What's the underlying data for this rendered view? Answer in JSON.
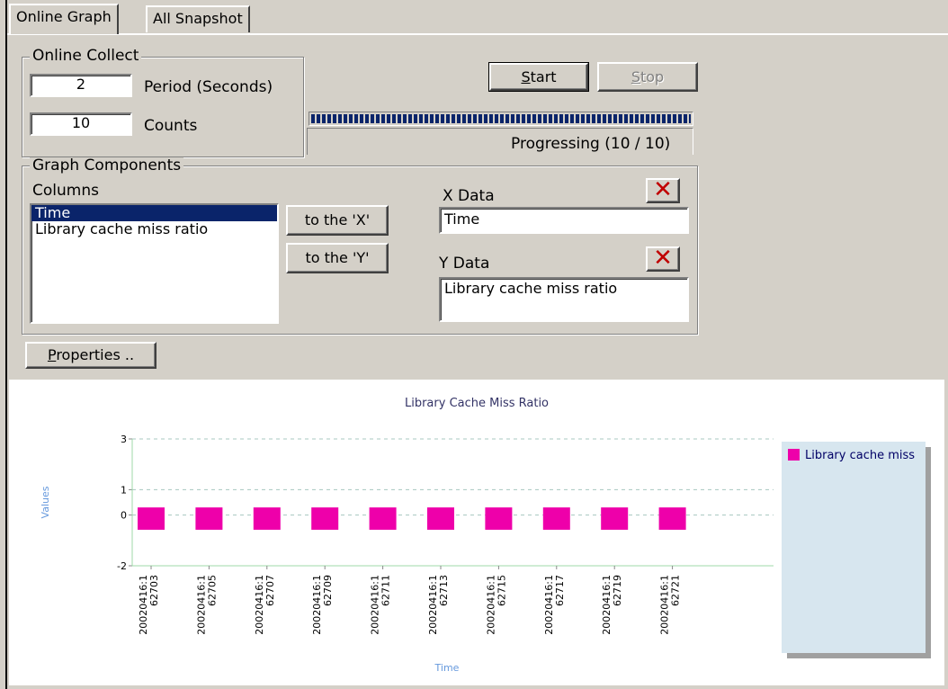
{
  "tabs": [
    {
      "label": "Online Graph",
      "active": true
    },
    {
      "label": "All Snapshot",
      "active": false
    }
  ],
  "online_collect": {
    "title": "Online Collect",
    "period_value": "2",
    "period_label": "Period (Seconds)",
    "counts_value": "10",
    "counts_label": "Counts"
  },
  "buttons": {
    "start": "Start",
    "stop": "Stop",
    "to_x": "to the 'X'",
    "to_y": "to the 'Y'",
    "properties": "Properties ..",
    "clear_icon": "✕"
  },
  "progress": {
    "text": "Progressing (10 / 10)",
    "current": 10,
    "total": 10
  },
  "graph_components": {
    "title": "Graph Components",
    "columns_label": "Columns",
    "columns": [
      "Time",
      "Library cache miss ratio"
    ],
    "selected_column": 0,
    "x_label": "X Data",
    "x_value": "Time",
    "y_label": "Y Data",
    "y_value": "Library cache miss ratio"
  },
  "colors": {
    "bar": "#ee00aa",
    "selection": "#0a246a",
    "legend_bg": "#d7e6ef",
    "axis_label": "#6699dd"
  },
  "chart_data": {
    "type": "bar",
    "title": "Library Cache Miss Ratio",
    "xlabel": "Time",
    "ylabel": "Values",
    "categories": [
      "20020416:162703",
      "20020416:162705",
      "20020416:162707",
      "20020416:162709",
      "20020416:162711",
      "20020416:162713",
      "20020416:162715",
      "20020416:162717",
      "20020416:162719",
      "20020416:162721"
    ],
    "tick_labels": [
      [
        "20020416:1",
        "62703"
      ],
      [
        "20020416:1",
        "62705"
      ],
      [
        "20020416:1",
        "62707"
      ],
      [
        "20020416:1",
        "62709"
      ],
      [
        "20020416:1",
        "62711"
      ],
      [
        "20020416:1",
        "62713"
      ],
      [
        "20020416:1",
        "62715"
      ],
      [
        "20020416:1",
        "62717"
      ],
      [
        "20020416:1",
        "62719"
      ],
      [
        "20020416:1",
        "62721"
      ]
    ],
    "series": [
      {
        "name": "Library cache miss",
        "values": [
          0.3,
          0.3,
          0.3,
          0.3,
          0.3,
          0.3,
          0.3,
          0.3,
          0.3,
          0.3
        ]
      }
    ],
    "ylim": [
      -2,
      3
    ],
    "yticks": [
      3,
      1,
      0,
      -2
    ],
    "grid": true,
    "legend_position": "right"
  }
}
